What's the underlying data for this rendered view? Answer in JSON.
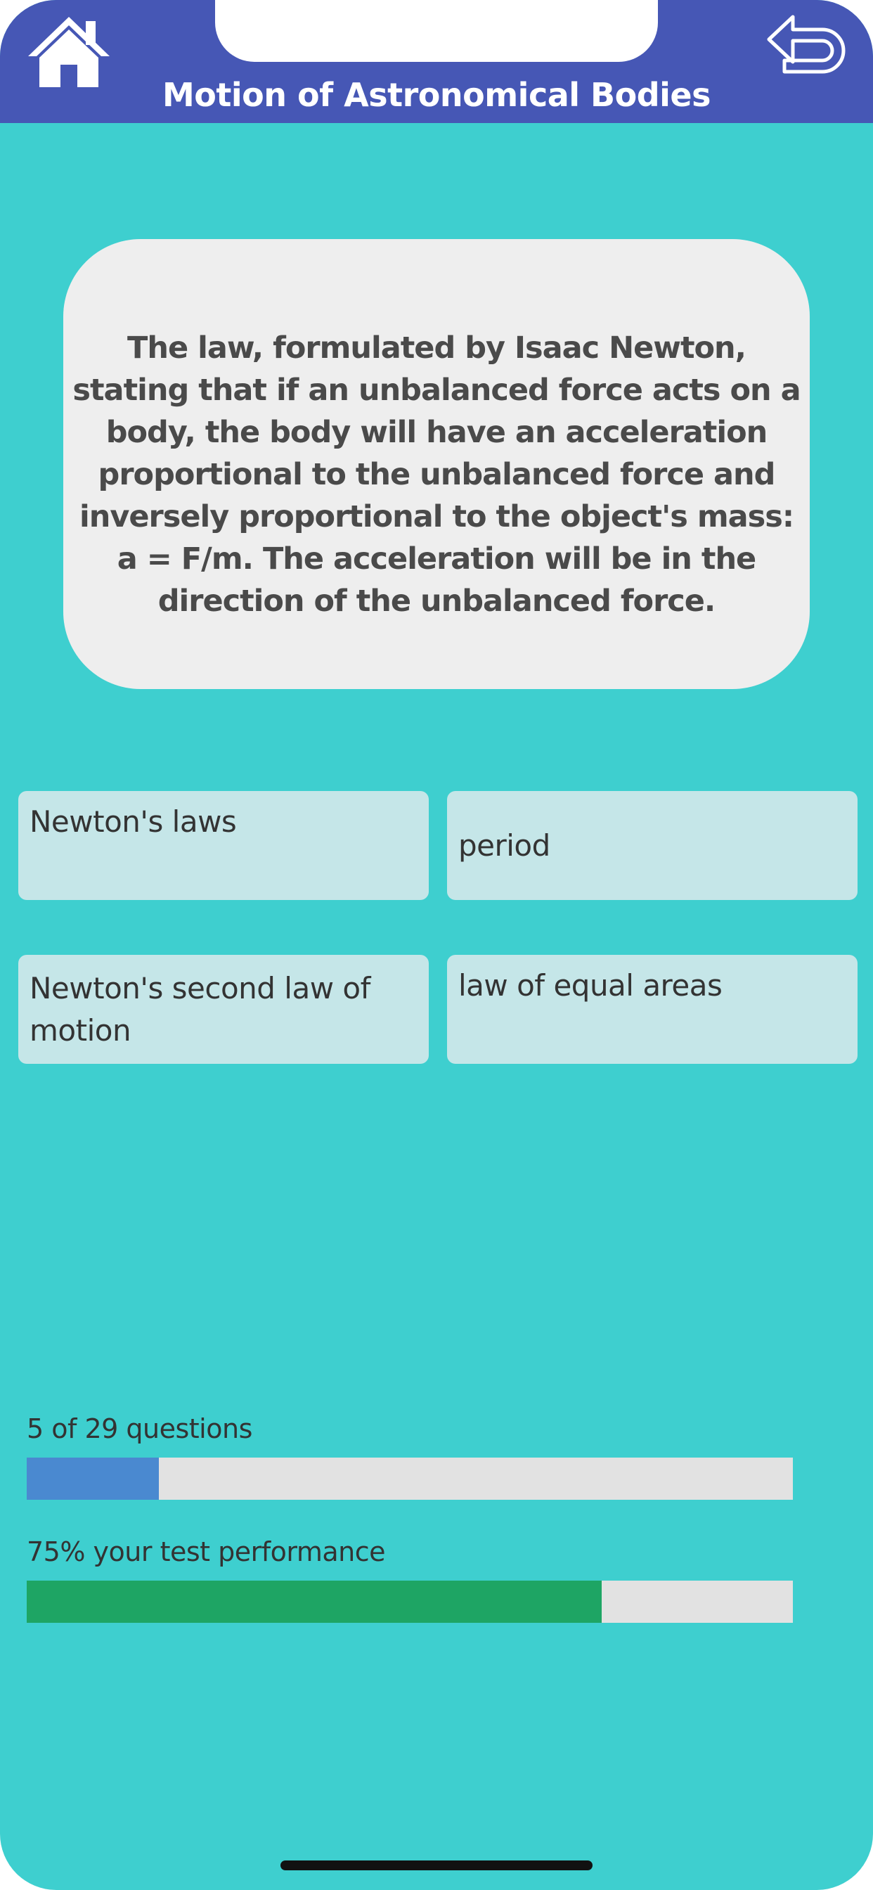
{
  "header": {
    "title": "Motion of Astronomical Bodies",
    "home_icon": "home-icon",
    "back_icon": "back-arrow-icon",
    "background_color": "#4657b5"
  },
  "question": {
    "text": "The law, formulated by Isaac Newton, stating that if an unbalanced force acts on a body, the body will have an acceleration proportional to the unbalanced force and inversely proportional to the object's mass: a = F/m. The acceleration will be in the direction of the unbalanced force."
  },
  "answers": [
    {
      "label": "Newton's laws"
    },
    {
      "label": "period"
    },
    {
      "label": "Newton's second law of motion"
    },
    {
      "label": "law of equal areas"
    }
  ],
  "progress": {
    "questions_label": "5 of 29 questions",
    "questions_current": 5,
    "questions_total": 29,
    "questions_color": "#4a89d0",
    "performance_label": "75% your test performance",
    "performance_percent": 75,
    "performance_color": "#1ea564"
  },
  "colors": {
    "screen_background": "#3ecfcf",
    "card_background": "#eeeeee",
    "answer_background": "#c5e6e8",
    "track_background": "#e2e2e2"
  }
}
